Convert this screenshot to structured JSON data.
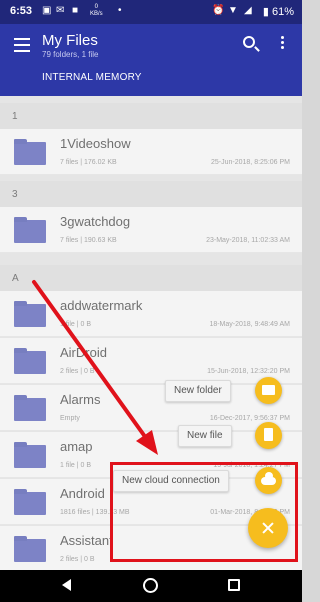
{
  "status_bar": {
    "time": "6:53",
    "network_speed_value": "0",
    "network_speed_unit": "KB/s",
    "battery": "61%"
  },
  "appbar": {
    "title": "My Files",
    "subtitle": "79 folders, 1 file",
    "tab": "INTERNAL MEMORY"
  },
  "sections": [
    "1",
    "3",
    "A"
  ],
  "files": [
    {
      "name": "1Videoshow",
      "info": "7 files  |  176.02 KB",
      "date": "25-Jun-2018, 8:25:06 PM"
    },
    {
      "name": "3gwatchdog",
      "info": "7 files  |  190.63 KB",
      "date": "23-May-2018, 11:02:33 AM"
    },
    {
      "name": "addwatermark",
      "info": "1 file  |  0 B",
      "date": "18-May-2018, 9:48:49 AM"
    },
    {
      "name": "AirDroid",
      "info": "2 files  |  0 B",
      "date": "15-Jun-2018, 12:32:20 PM"
    },
    {
      "name": "Alarms",
      "info": "Empty",
      "date": "16-Dec-2017, 9:56:37 PM"
    },
    {
      "name": "amap",
      "info": "1 file  |  0 B",
      "date": "15-Jul-2018, 1:24:27 PM"
    },
    {
      "name": "Android",
      "info": "1816 files  |  139.23 MB",
      "date": "01-Mar-2018, 8:23:00 PM"
    },
    {
      "name": "Assistant",
      "info": "2 files  |  0 B",
      "date": ""
    }
  ],
  "fab_menu": {
    "new_folder": "New folder",
    "new_file": "New file",
    "new_cloud_connection": "New cloud connection"
  },
  "colors": {
    "status_bar": "#20277a",
    "app_bar": "#2d38a7",
    "fab": "#f6bd1e",
    "annotation": "#e0121b"
  }
}
